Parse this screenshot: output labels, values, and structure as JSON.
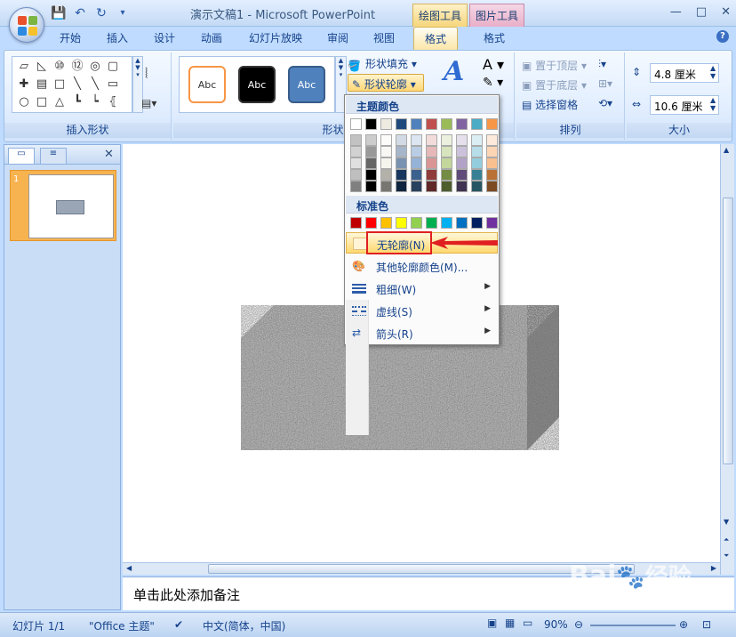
{
  "window": {
    "title": "演示文稿1 - Microsoft PowerPoint",
    "context_tab_drawing": "绘图工具",
    "context_tab_picture": "图片工具",
    "min": "—",
    "max": "□",
    "close": "✕",
    "help": "?"
  },
  "tabs": [
    "开始",
    "插入",
    "设计",
    "动画",
    "幻灯片放映",
    "审阅",
    "视图",
    "格式",
    "格式"
  ],
  "ribbon": {
    "insert_shapes_label": "插入形状",
    "shape_styles_label": "形状样式",
    "style_abc": [
      "Abc",
      "Abc",
      "Abc"
    ],
    "shape_fill": "形状填充",
    "shape_outline": "形状轮廓",
    "quick_styles_partial": "快速样式",
    "arrange_label": "排列",
    "bring_front": "置于顶层",
    "send_back": "置于底层",
    "selection_pane": "选择窗格",
    "size_label": "大小",
    "height_value": "4.8 厘米",
    "width_value": "10.6 厘米"
  },
  "outline_menu": {
    "theme_colors_header": "主题颜色",
    "standard_colors_header": "标准色",
    "no_outline": "无轮廓(N)",
    "more_colors": "其他轮廓颜色(M)...",
    "weight": "粗细(W)",
    "dashes": "虚线(S)",
    "arrows": "箭头(R)",
    "theme_top_row": [
      "#ffffff",
      "#000000",
      "#eeece1",
      "#1f497d",
      "#4f81bd",
      "#c0504d",
      "#9bbb59",
      "#8064a2",
      "#4bacc6",
      "#f79646"
    ],
    "standard_colors": [
      "#c00000",
      "#ff0000",
      "#ffc000",
      "#ffff00",
      "#92d050",
      "#00b050",
      "#00b0f0",
      "#0070c0",
      "#002060",
      "#7030a0"
    ]
  },
  "slides_pane": {
    "slide_number": "1",
    "close": "✕"
  },
  "notes_placeholder": "单击此处添加备注",
  "status": {
    "slide": "幻灯片 1/1",
    "theme": "\"Office 主题\"",
    "language": "中文(简体，中国)",
    "zoom": "90%"
  },
  "watermark": {
    "brand": "Bai",
    "brand2": "经验",
    "url": "jingyan.baidu.com"
  }
}
